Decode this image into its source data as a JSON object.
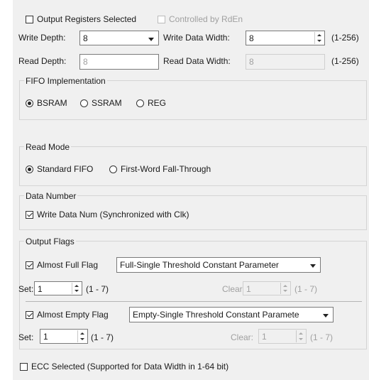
{
  "output_registers": {
    "label": "Output Registers Selected",
    "checked": false
  },
  "controlled_by_rden": {
    "label": "Controlled by RdEn",
    "checked": false,
    "enabled": false
  },
  "write_depth": {
    "label": "Write Depth:",
    "value": "8"
  },
  "write_data_width": {
    "label": "Write Data Width:",
    "value": "8",
    "range": "(1-256)"
  },
  "read_depth": {
    "label": "Read Depth:",
    "value": "8"
  },
  "read_data_width": {
    "label": "Read Data Width:",
    "value": "8",
    "range": "(1-256)"
  },
  "fifo_implementation": {
    "title": "FIFO Implementation",
    "options": [
      "BSRAM",
      "SSRAM",
      "REG"
    ],
    "selected": "BSRAM"
  },
  "read_mode": {
    "title": "Read Mode",
    "options": [
      "Standard FIFO",
      "First-Word Fall-Through"
    ],
    "selected": "Standard FIFO"
  },
  "data_number": {
    "title": "Data Number",
    "write_data_num": {
      "label": "Write Data Num (Synchronized with Clk)",
      "checked": true
    }
  },
  "output_flags": {
    "title": "Output Flags",
    "almost_full": {
      "label": "Almost Full Flag",
      "checked": true,
      "mode": "Full-Single Threshold Constant Parameter",
      "set_label": "Set:",
      "set_value": "1",
      "set_range": "(1 - 7)",
      "clear_label": "Clear:",
      "clear_value": "1",
      "clear_range": "(1 - 7)"
    },
    "almost_empty": {
      "label": "Almost Empty Flag",
      "checked": true,
      "mode": "Empty-Single Threshold Constant Paramete",
      "set_label": "Set:",
      "set_value": "1",
      "set_range": "(1 - 7)",
      "clear_label": "Clear:",
      "clear_value": "1",
      "clear_range": "(1 - 7)"
    }
  },
  "ecc": {
    "label": "ECC Selected (Supported for Data Width in 1-64 bit)",
    "checked": false
  }
}
